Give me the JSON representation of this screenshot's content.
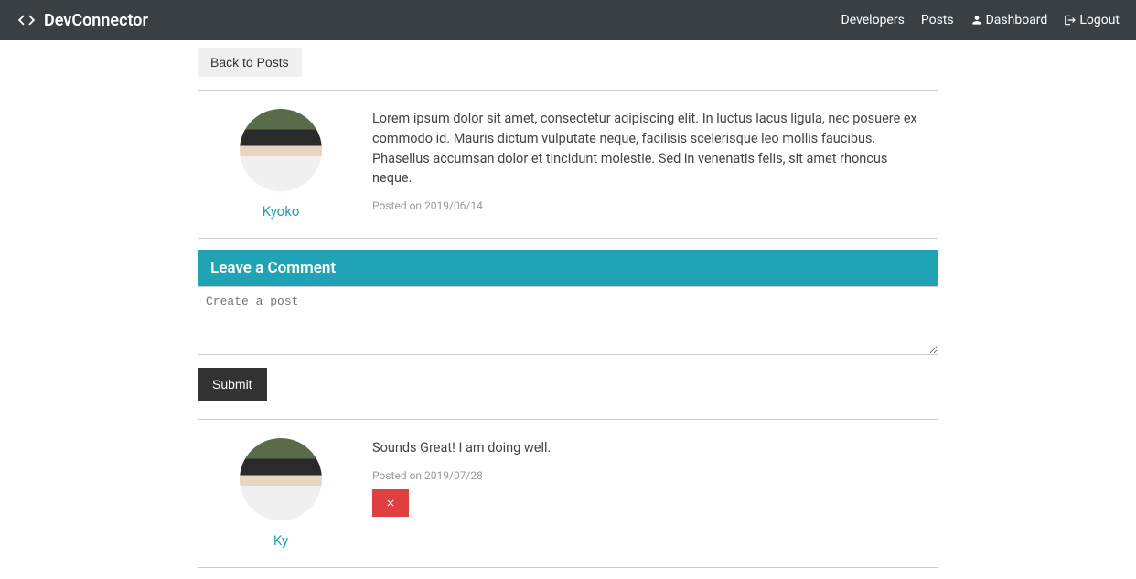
{
  "navbar": {
    "brand": "DevConnector",
    "links": {
      "developers": "Developers",
      "posts": "Posts",
      "dashboard": "Dashboard",
      "logout": "Logout"
    }
  },
  "back_button": "Back to Posts",
  "post": {
    "author": "Kyoko",
    "text": "Lorem ipsum dolor sit amet, consectetur adipiscing elit. In luctus lacus ligula, nec posuere ex commodo id. Mauris dictum vulputate neque, facilisis scelerisque leo mollis faucibus. Phasellus accumsan dolor et tincidunt molestie. Sed in venenatis felis, sit amet rhoncus neque.",
    "date": "Posted on 2019/06/14"
  },
  "comment_section": {
    "header": "Leave a Comment",
    "placeholder": "Create a post",
    "submit": "Submit"
  },
  "comments": [
    {
      "author": "Ky",
      "text": "Sounds Great!    I am doing well.",
      "date": "Posted on 2019/07/28"
    }
  ]
}
